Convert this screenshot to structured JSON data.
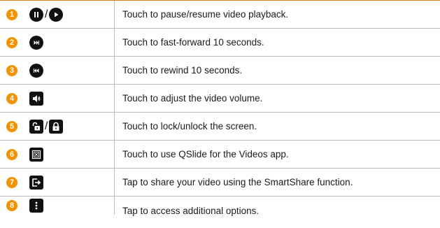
{
  "colors": {
    "accent": "#f39200",
    "icon": "#111111",
    "border": "#bdbdbd",
    "top_rule": "#e08020"
  },
  "rows": [
    {
      "number": "1",
      "icons": [
        "pause-icon",
        "play-icon"
      ],
      "separator": "/",
      "description": "Touch to pause/resume video playback."
    },
    {
      "number": "2",
      "icons": [
        "fast-forward-icon"
      ],
      "description": "Touch to fast-forward 10 seconds."
    },
    {
      "number": "3",
      "icons": [
        "rewind-icon"
      ],
      "description": "Touch to rewind 10 seconds."
    },
    {
      "number": "4",
      "icons": [
        "volume-icon"
      ],
      "description": "Touch to adjust the video volume."
    },
    {
      "number": "5",
      "icons": [
        "unlock-icon",
        "lock-icon"
      ],
      "separator": "/",
      "description": "Touch to lock/unlock the screen."
    },
    {
      "number": "6",
      "icons": [
        "qslide-icon"
      ],
      "description": "Touch to use QSlide for the Videos app."
    },
    {
      "number": "7",
      "icons": [
        "smartshare-icon"
      ],
      "description": "Tap to share your video using the SmartShare function."
    },
    {
      "number": "8",
      "icons": [
        "more-options-icon"
      ],
      "description": "Tap to access additional options."
    }
  ]
}
